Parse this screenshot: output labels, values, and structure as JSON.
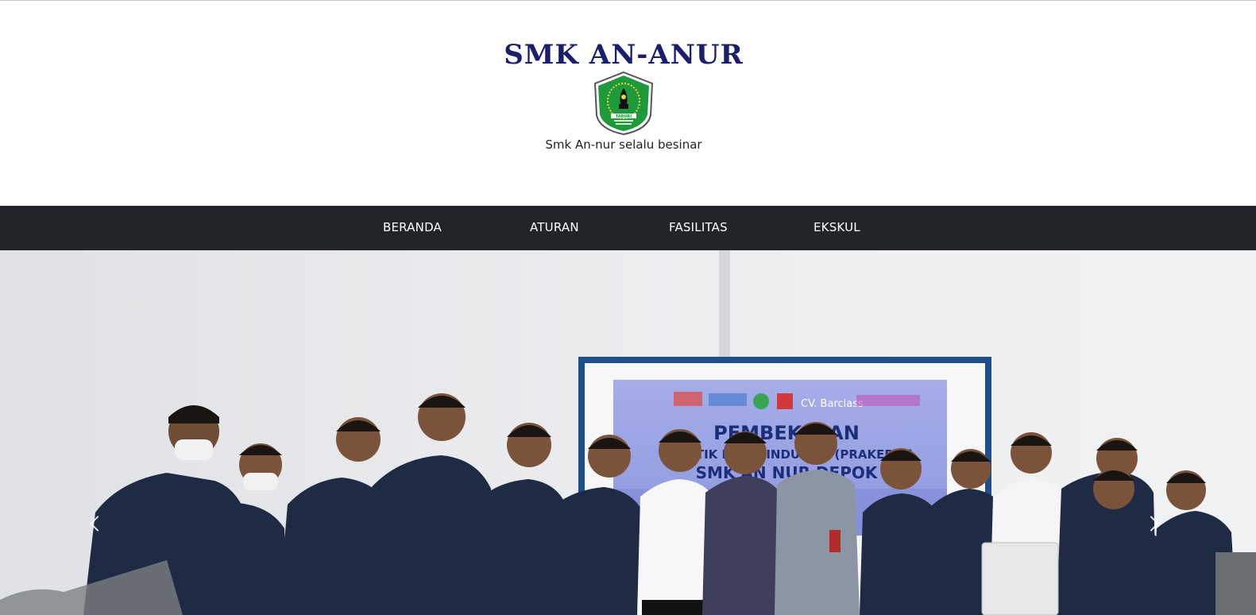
{
  "header": {
    "title": "SMK AN-ANUR",
    "tagline": "Smk An-nur selalu besinar",
    "logo_text": "YAYASAN PENDIDIKAN ISLAM AN-NUR"
  },
  "nav": {
    "items": [
      {
        "label": "BERANDA"
      },
      {
        "label": "ATURAN"
      },
      {
        "label": "FASILITAS"
      },
      {
        "label": "EKSKUL"
      }
    ]
  },
  "carousel": {
    "banner_title": "PEMBEKALAN",
    "banner_line2": "PRAKTIK KERJA INDUSTRI (PRAKERIN)",
    "banner_line3": "SMK AN NUR DEPOK",
    "banner_sponsor": "CV. Barclass",
    "prev_label": "Previous",
    "next_label": "Next"
  },
  "colors": {
    "title": "#1b1f6b",
    "navbar": "#212529",
    "nav_text": "#ffffff",
    "logo_green": "#1e9a3a",
    "uniform": "#1f2a44"
  }
}
